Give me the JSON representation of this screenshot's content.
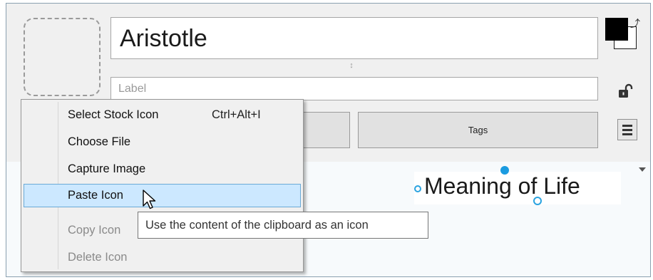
{
  "editor": {
    "title_value": "Aristotle",
    "label_placeholder": "Label",
    "tags_button_label": "Tags",
    "resize_grip_glyph": "↕",
    "color_swatch": {
      "foreground": "#000000",
      "background": "#ffffff"
    }
  },
  "canvas": {
    "topic_text": "Meaning of Life",
    "selection_color": "#1a9be0"
  },
  "context_menu": {
    "items": [
      {
        "label": "Select Stock Icon",
        "shortcut": "Ctrl+Alt+I",
        "enabled": true
      },
      {
        "label": "Choose File",
        "enabled": true
      },
      {
        "label": "Capture Image",
        "enabled": true
      },
      {
        "label": "Paste Icon",
        "enabled": true,
        "highlighted": true
      },
      {
        "label": "Copy Icon",
        "enabled": false
      },
      {
        "label": "Delete Icon",
        "enabled": false
      }
    ]
  },
  "tooltip": {
    "text": "Use the content of the clipboard as an icon"
  },
  "icons": {
    "icon_drop": "image-placeholder-icon",
    "swap": "swap-colors-icon",
    "lock": "lock-open-icon",
    "menu": "hamburger-menu-icon",
    "dropdown": "dropdown-arrow-icon",
    "cursor": "mouse-pointer-icon"
  }
}
